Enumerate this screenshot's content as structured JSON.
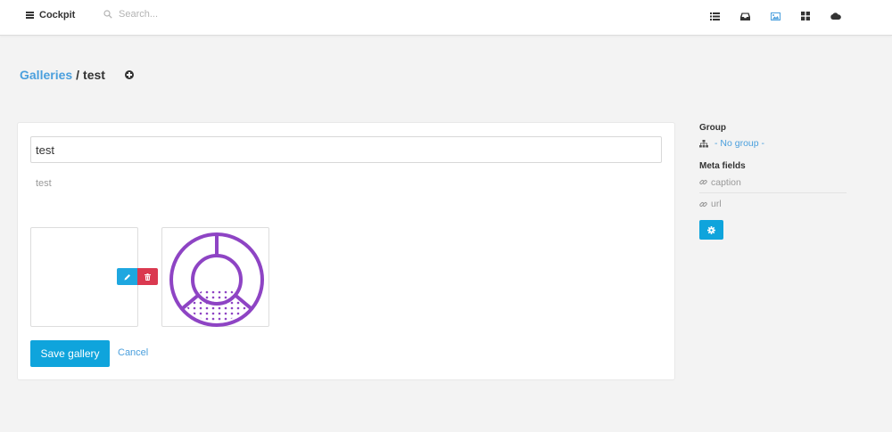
{
  "app": {
    "brand": "Cockpit",
    "search_placeholder": "Search...",
    "nav_icons": [
      "list-icon",
      "inbox-icon",
      "image-icon",
      "grid-icon",
      "cloud-icon"
    ],
    "active_nav": "image-icon"
  },
  "breadcrumb": {
    "parent": "Galleries",
    "separator": "/",
    "current": "test"
  },
  "gallery": {
    "name_value": "test",
    "description": "test",
    "images": [
      "blank-image",
      "purple-ring-image"
    ],
    "save_label": "Save gallery",
    "cancel_label": "Cancel"
  },
  "sidebar": {
    "group_heading": "Group",
    "group_value": "- No group -",
    "meta_heading": "Meta fields",
    "meta_fields": [
      "caption",
      "url"
    ]
  },
  "colors": {
    "accent": "#0fa4dc",
    "link": "#4a9fdd",
    "danger": "#da3950",
    "ring": "#8e44c4"
  }
}
